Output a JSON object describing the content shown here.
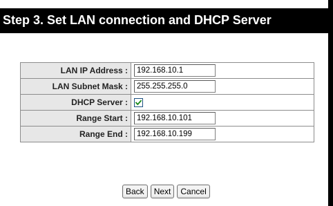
{
  "header": {
    "title": "Step 3. Set LAN connection and DHCP Server"
  },
  "form": {
    "lan_ip": {
      "label": "LAN IP Address :",
      "value": "192.168.10.1"
    },
    "subnet_mask": {
      "label": "LAN Subnet Mask :",
      "value": "255.255.255.0"
    },
    "dhcp_server": {
      "label": "DHCP Server :",
      "checked": true
    },
    "range_start": {
      "label": "Range Start :",
      "value": "192.168.10.101"
    },
    "range_end": {
      "label": "Range End :",
      "value": "192.168.10.199"
    }
  },
  "buttons": {
    "back": "Back",
    "next": "Next",
    "cancel": "Cancel"
  },
  "colors": {
    "title_bar": "#000000",
    "title_text": "#ffffff",
    "label_bg": "#e7e7e7",
    "checkbox_border": "#1c5180",
    "checkmark": "#1a8a1a"
  },
  "icons": {
    "checkbox": "checkmark-icon"
  }
}
